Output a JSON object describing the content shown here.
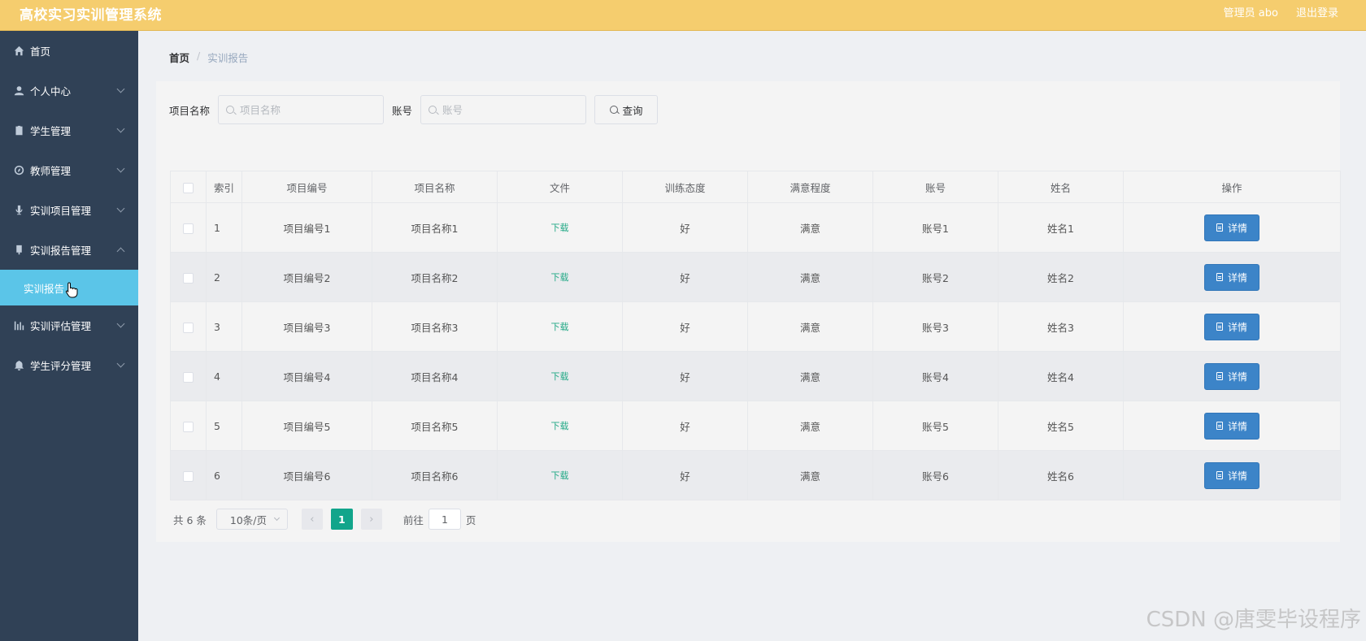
{
  "header": {
    "title": "高校实习实训管理系统",
    "user_label": "管理员 abo",
    "logout_label": "退出登录",
    "bg_color": "#f5cd6e"
  },
  "sidebar": {
    "items": [
      {
        "label": "首页",
        "icon": "home-icon",
        "expandable": false
      },
      {
        "label": "个人中心",
        "icon": "user-icon",
        "expandable": true
      },
      {
        "label": "学生管理",
        "icon": "clipboard-icon",
        "expandable": true
      },
      {
        "label": "教师管理",
        "icon": "compass-icon",
        "expandable": true
      },
      {
        "label": "实训项目管理",
        "icon": "microphone-icon",
        "expandable": true
      },
      {
        "label": "实训报告管理",
        "icon": "document-icon",
        "expandable": true,
        "expanded": true
      },
      {
        "label": "实训评估管理",
        "icon": "chart-icon",
        "expandable": true
      },
      {
        "label": "学生评分管理",
        "icon": "bell-icon",
        "expandable": true
      }
    ],
    "active_submenu": "实训报告",
    "active_color": "#5bc5e8"
  },
  "breadcrumb": {
    "home": "首页",
    "separator": "/",
    "current": "实训报告"
  },
  "search": {
    "project_label": "项目名称",
    "project_placeholder": "项目名称",
    "project_value": "",
    "account_label": "账号",
    "account_placeholder": "账号",
    "account_value": "",
    "query_label": "查询"
  },
  "table": {
    "headers": [
      "索引",
      "项目编号",
      "项目名称",
      "文件",
      "训练态度",
      "满意程度",
      "账号",
      "姓名",
      "操作"
    ],
    "rows": [
      {
        "index": "1",
        "code": "项目编号1",
        "name": "项目名称1",
        "file": "下载",
        "attitude": "好",
        "satisfaction": "满意",
        "account": "账号1",
        "person": "姓名1",
        "action": "详情"
      },
      {
        "index": "2",
        "code": "项目编号2",
        "name": "项目名称2",
        "file": "下载",
        "attitude": "好",
        "satisfaction": "满意",
        "account": "账号2",
        "person": "姓名2",
        "action": "详情"
      },
      {
        "index": "3",
        "code": "项目编号3",
        "name": "项目名称3",
        "file": "下载",
        "attitude": "好",
        "satisfaction": "满意",
        "account": "账号3",
        "person": "姓名3",
        "action": "详情"
      },
      {
        "index": "4",
        "code": "项目编号4",
        "name": "项目名称4",
        "file": "下载",
        "attitude": "好",
        "satisfaction": "满意",
        "account": "账号4",
        "person": "姓名4",
        "action": "详情"
      },
      {
        "index": "5",
        "code": "项目编号5",
        "name": "项目名称5",
        "file": "下载",
        "attitude": "好",
        "satisfaction": "满意",
        "account": "账号5",
        "person": "姓名5",
        "action": "详情"
      },
      {
        "index": "6",
        "code": "项目编号6",
        "name": "项目名称6",
        "file": "下载",
        "attitude": "好",
        "satisfaction": "满意",
        "account": "账号6",
        "person": "姓名6",
        "action": "详情"
      }
    ]
  },
  "pagination": {
    "total": "共 6 条",
    "page_size": "10条/页",
    "prev": "‹",
    "current_page": "1",
    "next": "›",
    "goto_label": "前往",
    "goto_value": "1",
    "page_suffix": "页"
  },
  "watermark": "CSDN @唐雯毕设程序"
}
